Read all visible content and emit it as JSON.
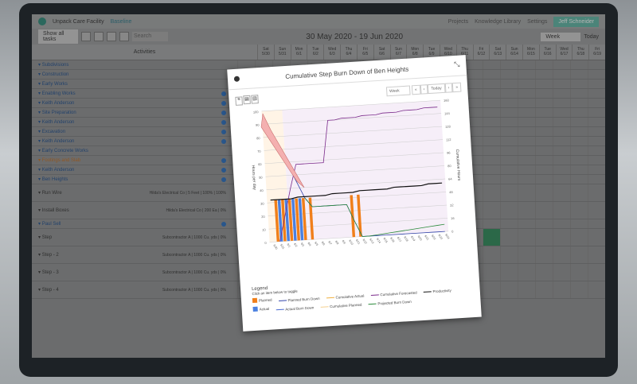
{
  "app": {
    "title": "Unpack Care Facility",
    "subtitle": "Baseline",
    "nav": [
      "Projects",
      "Knowledge Library",
      "Settings"
    ],
    "user": "Jeff Schneider"
  },
  "toolbar": {
    "filter": "Show all tasks",
    "search_placeholder": "Search",
    "date_range": "30 May 2020 - 19 Jun 2020",
    "view": "Week",
    "today": "Today"
  },
  "grid": {
    "activities_label": "Activities",
    "days": [
      [
        "Sat",
        "5/30"
      ],
      [
        "Sun",
        "5/31"
      ],
      [
        "Mon",
        "6/1"
      ],
      [
        "Tue",
        "6/2"
      ],
      [
        "Wed",
        "6/3"
      ],
      [
        "Thu",
        "6/4"
      ],
      [
        "Fri",
        "6/5"
      ],
      [
        "Sat",
        "6/6"
      ],
      [
        "Sun",
        "6/7"
      ],
      [
        "Mon",
        "6/8"
      ],
      [
        "Tue",
        "6/9"
      ],
      [
        "Wed",
        "6/10"
      ],
      [
        "Thu",
        "6/11"
      ],
      [
        "Fri",
        "6/12"
      ],
      [
        "Sat",
        "6/13"
      ],
      [
        "Sun",
        "6/14"
      ],
      [
        "Mon",
        "6/15"
      ],
      [
        "Tue",
        "6/16"
      ],
      [
        "Wed",
        "6/17"
      ],
      [
        "Thu",
        "6/18"
      ],
      [
        "Fri",
        "6/19"
      ]
    ],
    "rows": [
      {
        "label": "Subdivisions",
        "type": "group"
      },
      {
        "label": "Construction",
        "type": "group"
      },
      {
        "label": "Early Works",
        "type": "group"
      },
      {
        "label": "Enabling Works",
        "type": "task"
      },
      {
        "label": "Keith Anderson",
        "type": "person"
      },
      {
        "label": "Site Preparation",
        "type": "task"
      },
      {
        "label": "Keith Anderson",
        "type": "person"
      },
      {
        "label": "Excavation",
        "type": "task"
      },
      {
        "label": "Keith Anderson",
        "type": "person"
      },
      {
        "label": "Early Concrete Works",
        "type": "group"
      },
      {
        "label": "Footings and Slab",
        "type": "task",
        "highlight": true
      },
      {
        "label": "Keith Anderson",
        "type": "person"
      },
      {
        "label": "Ben Heights",
        "type": "person"
      },
      {
        "label": "Run Wire",
        "type": "step",
        "crew": "Hilda's Electrical Co",
        "qty": "5 Feet",
        "completed": "100%",
        "perf": "100%"
      },
      {
        "label": "Install Boxes",
        "type": "step",
        "crew": "Hilda's Electrical Co",
        "qty": "200 Ea",
        "completed": "0%"
      },
      {
        "label": "Paul Sell",
        "type": "person"
      },
      {
        "label": "Step",
        "type": "step",
        "crew": "Subcontractor A",
        "qty": "1000 Cu. yds",
        "completed": "0%"
      },
      {
        "label": "Step - 2",
        "type": "step",
        "crew": "Subcontractor A",
        "qty": "1000 Cu. yds",
        "completed": "0%"
      },
      {
        "label": "Step - 3",
        "type": "step",
        "crew": "Subcontractor A",
        "qty": "1000 Cu. yds",
        "completed": "0%"
      },
      {
        "label": "Step - 4",
        "type": "step",
        "crew": "Subcontractor A",
        "qty": "1000 Cu. yds",
        "completed": "0%"
      }
    ]
  },
  "modal": {
    "title": "Cumulative Step Burn Down of Ben Heights",
    "view": "Week",
    "today": "Today",
    "legend_title": "Legend",
    "legend_hint": "Click an item below to toggle",
    "legend": [
      {
        "label": "Planned",
        "color": "#f07f1a",
        "kind": "bar"
      },
      {
        "label": "Planned Burn Down",
        "color": "#3344aa",
        "kind": "line"
      },
      {
        "label": "Cumulative Actual",
        "color": "#f0b040",
        "kind": "line"
      },
      {
        "label": "Cumulative Forecasted",
        "color": "#7a2a8a",
        "kind": "line"
      },
      {
        "label": "Productivity",
        "color": "#111111",
        "kind": "line"
      },
      {
        "label": "Actual",
        "color": "#4a80e0",
        "kind": "bar"
      },
      {
        "label": "Actual Burn Down",
        "color": "#4a6ad0",
        "kind": "line"
      },
      {
        "label": "Cumulative Planned",
        "color": "#f5d090",
        "kind": "line"
      },
      {
        "label": "Projected Burn Down",
        "color": "#2a8a3a",
        "kind": "line"
      }
    ]
  },
  "chart_data": {
    "type": "bar",
    "title": "Cumulative Step Burn Down of Ben Heights",
    "ylabel": "Hours per day",
    "y2label": "Cumulative Hours",
    "ylim": [
      0,
      100
    ],
    "y2lim": [
      0,
      160
    ],
    "categories": [
      "5/30",
      "5/31",
      "6/1",
      "6/2",
      "6/3",
      "6/4",
      "6/5",
      "6/6",
      "6/7",
      "6/8",
      "6/9",
      "6/10",
      "6/11",
      "6/12",
      "6/13",
      "6/14",
      "6/15",
      "6/16",
      "6/17",
      "6/18",
      "6/19",
      "6/20",
      "6/21",
      "6/22",
      "6/23",
      "6/24"
    ],
    "series": [
      {
        "name": "Planned",
        "kind": "bar",
        "values": [
          0,
          32,
          32,
          32,
          32,
          32,
          32,
          0,
          0,
          0,
          0,
          0,
          32,
          32,
          0,
          0,
          0,
          0,
          0,
          0,
          0,
          0,
          0,
          0,
          0,
          0
        ]
      },
      {
        "name": "Actual",
        "kind": "bar",
        "values": [
          0,
          32,
          32,
          32,
          32,
          0,
          0,
          0,
          0,
          0,
          0,
          0,
          0,
          0,
          0,
          0,
          0,
          0,
          0,
          0,
          0,
          0,
          0,
          0,
          0,
          0
        ]
      },
      {
        "name": "Planned Burn Down",
        "kind": "line",
        "values": [
          92,
          80,
          68,
          56,
          44,
          32,
          25,
          25,
          25,
          25,
          25,
          25,
          12,
          0,
          0,
          0,
          0,
          0,
          0,
          0,
          0,
          0,
          0,
          0,
          0,
          0
        ]
      },
      {
        "name": "Cumulative Forecasted",
        "kind": "line",
        "values": [
          null,
          0,
          20,
          40,
          58,
          58,
          58,
          58,
          58,
          90,
          90,
          91,
          91,
          91,
          92,
          92,
          92,
          93,
          93,
          93,
          94,
          94,
          94,
          95,
          95,
          95
        ]
      },
      {
        "name": "Productivity",
        "kind": "line",
        "values": [
          32,
          32,
          32,
          32,
          33,
          33,
          33,
          33,
          33,
          34,
          34,
          34,
          34,
          35,
          35,
          35,
          35,
          35,
          36,
          36,
          36,
          36,
          36,
          37,
          37,
          37
        ]
      },
      {
        "name": "Projected Burn Down",
        "kind": "line",
        "values": [
          null,
          null,
          null,
          null,
          null,
          32,
          25,
          25,
          25,
          25,
          25,
          25,
          12,
          0,
          0,
          0.5,
          1,
          1.5,
          2,
          2.5,
          3,
          3.5,
          4,
          4.5,
          5,
          5.5
        ]
      }
    ]
  }
}
